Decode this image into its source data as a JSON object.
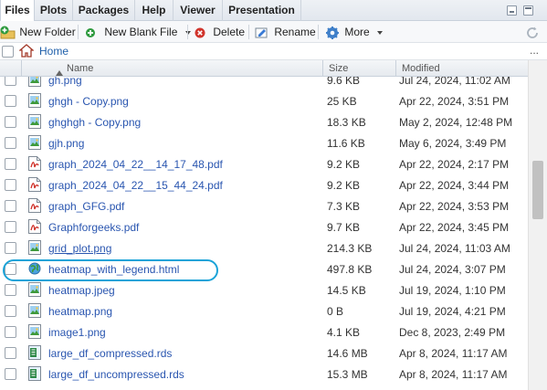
{
  "tabs": [
    {
      "label": "Files",
      "active": true
    },
    {
      "label": "Plots",
      "active": false
    },
    {
      "label": "Packages",
      "active": false
    },
    {
      "label": "Help",
      "active": false
    },
    {
      "label": "Viewer",
      "active": false
    },
    {
      "label": "Presentation",
      "active": false
    }
  ],
  "toolbar": {
    "new_folder": "New Folder",
    "new_blank_file": "New Blank File",
    "delete": "Delete",
    "rename": "Rename",
    "more": "More"
  },
  "path": {
    "home": "Home",
    "more": "..."
  },
  "columns": {
    "name": "Name",
    "size": "Size",
    "modified": "Modified"
  },
  "files": [
    {
      "name": "gh.png",
      "size": "9.6 KB",
      "modified": "Jul 24, 2024, 11:02 AM",
      "icon": "image-icon"
    },
    {
      "name": "ghgh - Copy.png",
      "size": "25 KB",
      "modified": "Apr 22, 2024, 3:51 PM",
      "icon": "image-icon"
    },
    {
      "name": "ghghgh - Copy.png",
      "size": "18.3 KB",
      "modified": "May 2, 2024, 12:48 PM",
      "icon": "image-icon"
    },
    {
      "name": "gjh.png",
      "size": "11.6 KB",
      "modified": "May 6, 2024, 3:49 PM",
      "icon": "image-icon"
    },
    {
      "name": "graph_2024_04_22__14_17_48.pdf",
      "size": "9.2 KB",
      "modified": "Apr 22, 2024, 2:17 PM",
      "icon": "pdf-icon"
    },
    {
      "name": "graph_2024_04_22__15_44_24.pdf",
      "size": "9.2 KB",
      "modified": "Apr 22, 2024, 3:44 PM",
      "icon": "pdf-icon"
    },
    {
      "name": "graph_GFG.pdf",
      "size": "7.3 KB",
      "modified": "Apr 22, 2024, 3:53 PM",
      "icon": "pdf-icon"
    },
    {
      "name": "Graphforgeeks.pdf",
      "size": "9.7 KB",
      "modified": "Apr 22, 2024, 3:45 PM",
      "icon": "pdf-icon"
    },
    {
      "name": "grid_plot.png",
      "size": "214.3 KB",
      "modified": "Jul 24, 2024, 11:03 AM",
      "icon": "image-icon"
    },
    {
      "name": "heatmap_with_legend.html",
      "size": "497.8 KB",
      "modified": "Jul 24, 2024, 3:07 PM",
      "icon": "html-globe-icon"
    },
    {
      "name": "heatmap.jpeg",
      "size": "14.5 KB",
      "modified": "Jul 19, 2024, 1:10 PM",
      "icon": "image-icon"
    },
    {
      "name": "heatmap.png",
      "size": "0 B",
      "modified": "Jul 19, 2024, 4:21 PM",
      "icon": "image-icon"
    },
    {
      "name": "image1.png",
      "size": "4.1 KB",
      "modified": "Dec 8, 2023, 2:49 PM",
      "icon": "image-icon"
    },
    {
      "name": "large_df_compressed.rds",
      "size": "14.6 MB",
      "modified": "Apr 8, 2024, 11:17 AM",
      "icon": "rds-icon"
    },
    {
      "name": "large_df_uncompressed.rds",
      "size": "15.3 MB",
      "modified": "Apr 8, 2024, 11:17 AM",
      "icon": "rds-icon"
    }
  ],
  "colors": {
    "link": "#2a56b0",
    "highlight": "#1aa3d8"
  }
}
